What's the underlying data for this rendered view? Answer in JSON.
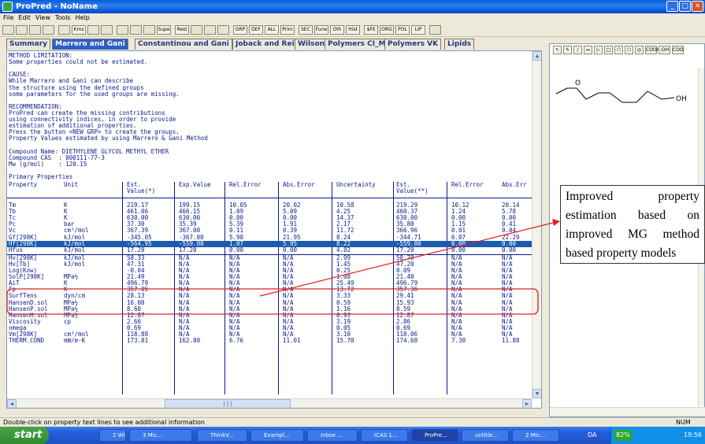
{
  "window": {
    "title": "ProPred - NoName",
    "minimize": "_",
    "maximize": "□",
    "close": "✕"
  },
  "menu": [
    "File",
    "Edit",
    "View",
    "Tools",
    "Help"
  ],
  "toolbar_icons": [
    "new-icon",
    "open-icon",
    "save-icon",
    "copy-icon",
    "paste-icon",
    "Kms",
    "structure-icon",
    "sigma-icon",
    "chart-icon",
    "book-icon",
    "network-icon",
    "Supe",
    "Rest",
    "molecule-icon",
    "graph-icon",
    "table-icon",
    "GRP",
    "DEF",
    "ALL",
    "Prim",
    "SEC",
    "Fune",
    "Oth",
    "Hist",
    "$Fit",
    "ORG",
    "POL",
    "LIP",
    "help-icon"
  ],
  "tabs": [
    "Summary",
    "Marrero and Gani",
    "Constantinou and Gani",
    "Joback and Reid",
    "Wilson",
    "Polymers CI_MG",
    "Polymers VK",
    "Lipids"
  ],
  "active_tab": 1,
  "text_lines": [
    "METHOD LIMITATION:",
    "Some properties could not be estimated.",
    "",
    "CAUSE:",
    "While Marrero and Gani can describe",
    "the structure using the defined groups",
    "some parameters for the used groups are missing.",
    "",
    "RECOMMENDATION:",
    "ProPred can create the missing contributions",
    "using connectivity indices, in order to provide",
    "estimation of additional properties.",
    "Press the button <NEW GRP> to create the groups.",
    "Property Values estimated by using Marrero & Gani Method",
    "",
    "Compound Name: DIETHYLENE GLYCOL METHYL ETHER",
    "Compound CAS  : 000111-77-3",
    "Mw (g/mol)    : 120.15",
    "",
    "Primary Properties"
  ],
  "table": {
    "headers": [
      [
        "Property"
      ],
      [
        "Unit"
      ],
      [
        "Est.",
        "Value(*)"
      ],
      [
        "Exp.Value"
      ],
      [
        "Rel.Error"
      ],
      [
        "Abs.Error"
      ],
      [
        "Uncertainty"
      ],
      [
        "Est.",
        "Value(**)"
      ],
      [
        "Rel.Error"
      ],
      [
        "Abs.Err"
      ]
    ],
    "rows": [
      [
        "Tm",
        "K",
        "219.17",
        "199.15",
        "10.05",
        "20.02",
        "10.58",
        "219.29",
        "10.12",
        "20.14"
      ],
      [
        "Tb",
        "K",
        "461.06",
        "466.15",
        "1.09",
        "5.09",
        "4.25",
        "460.37",
        "1.24",
        "5.78"
      ],
      [
        "Tc",
        "K",
        "630.00",
        "630.00",
        "0.00",
        "0.00",
        "14.37",
        "630.00",
        "0.00",
        "0.00"
      ],
      [
        "Pc",
        "bar",
        "37.30",
        "35.39",
        "5.39",
        "1.91",
        "2.17",
        "35.80",
        "1.15",
        "0.41"
      ],
      [
        "Vc",
        "cm³/mol",
        "367.39",
        "367.00",
        "0.11",
        "0.39",
        "11.72",
        "366.96",
        "0.01",
        "0.04"
      ],
      [
        "Gf[298K]",
        "kJ/mol",
        "-345.05",
        "-367.00",
        "5.98",
        "21.95",
        "8.24",
        "-344.71",
        "6.07",
        "22.29"
      ],
      [
        "Hf[298K]",
        "kJ/mol",
        "-564.95",
        "-559.00",
        "1.07",
        "5.95",
        "8.22",
        "-559.00",
        "0.00",
        "0.00"
      ],
      [
        "Hfus",
        "kJ/mol",
        "17.20",
        "17.20",
        "0.00",
        "0.00",
        "4.82",
        "17.20",
        "0.00",
        "0.00"
      ],
      [
        "Hv[298K]",
        "kJ/mol",
        "58.33",
        "N/A",
        "N/A",
        "N/A",
        "2.99",
        "58.70",
        "N/A",
        "N/A"
      ],
      [
        "Hv[Tb]",
        "kJ/mol",
        "47.31",
        "N/A",
        "N/A",
        "N/A",
        "1.45",
        "47.20",
        "N/A",
        "N/A"
      ],
      [
        "Log(Kow)",
        "",
        "-0.04",
        "N/A",
        "N/A",
        "N/A",
        "0.25",
        "0.09",
        "N/A",
        "N/A"
      ],
      [
        "SolP[298K]",
        "MPa½",
        "21.49",
        "N/A",
        "N/A",
        "N/A",
        "1.08",
        "21.40",
        "N/A",
        "N/A"
      ],
      [
        "AiT",
        "K",
        "496.79",
        "N/A",
        "N/A",
        "N/A",
        "25.49",
        "496.79",
        "N/A",
        "N/A"
      ],
      [
        "Fp",
        "K",
        "357.05",
        "N/A",
        "N/A",
        "N/A",
        "13.72",
        "357.36",
        "N/A",
        "N/A"
      ],
      [
        "SurfTens",
        "dyn/cm",
        "28.13",
        "N/A",
        "N/A",
        "N/A",
        "3.33",
        "29.41",
        "N/A",
        "N/A"
      ],
      [
        "HansenD.sol",
        "MPa½",
        "16.00",
        "N/A",
        "N/A",
        "N/A",
        "0.59",
        "15.93",
        "N/A",
        "N/A"
      ],
      [
        "HansenP.sol",
        "MPa½",
        "8.60",
        "N/A",
        "N/A",
        "N/A",
        "1.16",
        "8.59",
        "N/A",
        "N/A"
      ],
      [
        "HansenH.sol",
        "MPa½",
        "12.87",
        "N/A",
        "N/A",
        "N/A",
        "0.93",
        "12.87",
        "N/A",
        "N/A"
      ],
      [
        "Viscosity",
        "cp",
        "2.66",
        "N/A",
        "N/A",
        "N/A",
        "3.19",
        "2.86",
        "N/A",
        "N/A"
      ],
      [
        "omega",
        "",
        "0.69",
        "N/A",
        "N/A",
        "N/A",
        "0.05",
        "0.69",
        "N/A",
        "N/A"
      ],
      [
        "Vm[298K]",
        "cm³/mol",
        "118.88",
        "N/A",
        "N/A",
        "N/A",
        "3.10",
        "118.06",
        "N/A",
        "N/A"
      ],
      [
        "THERM.COND",
        "mW/m-K",
        "173.81",
        "162.80",
        "6.76",
        "11.01",
        "15.70",
        "174.68",
        "7.30",
        "11.88"
      ]
    ],
    "selected_row": 6
  },
  "draw_tools": [
    "pointer-icon",
    "pencil-icon",
    "line-icon",
    "bond-icon",
    "triangle-icon",
    "square-icon",
    "pentagon-icon",
    "hexagon-icon",
    "ring-icon",
    "COOH",
    "-OH",
    "COO"
  ],
  "molecule": {
    "o_label": "O",
    "oh_label": "OH"
  },
  "annotation": "Improved property estimation based on improved MG method based property models",
  "status_text": "Double-click on property text lines to see additional information",
  "status_num": "NUM",
  "taskbar": {
    "start": "start",
    "tasks": [
      "2 Wi...",
      "3 Mic...",
      "ThinkV...",
      "Exampl...",
      "Inbox ...",
      "ICAS 1...",
      "ProPre...",
      "untitle...",
      "2 Mic..."
    ],
    "active_task": 6,
    "lang": "DA",
    "battery": "82%",
    "clock": "19:56"
  },
  "colors": {
    "title_blue": "#0a5ad8",
    "tab_active": "#2d5ec8",
    "text_navy": "#0a1a8a",
    "selection": "#1c5cb0",
    "arrow": "#e02020",
    "start_green": "#3a9a38"
  }
}
